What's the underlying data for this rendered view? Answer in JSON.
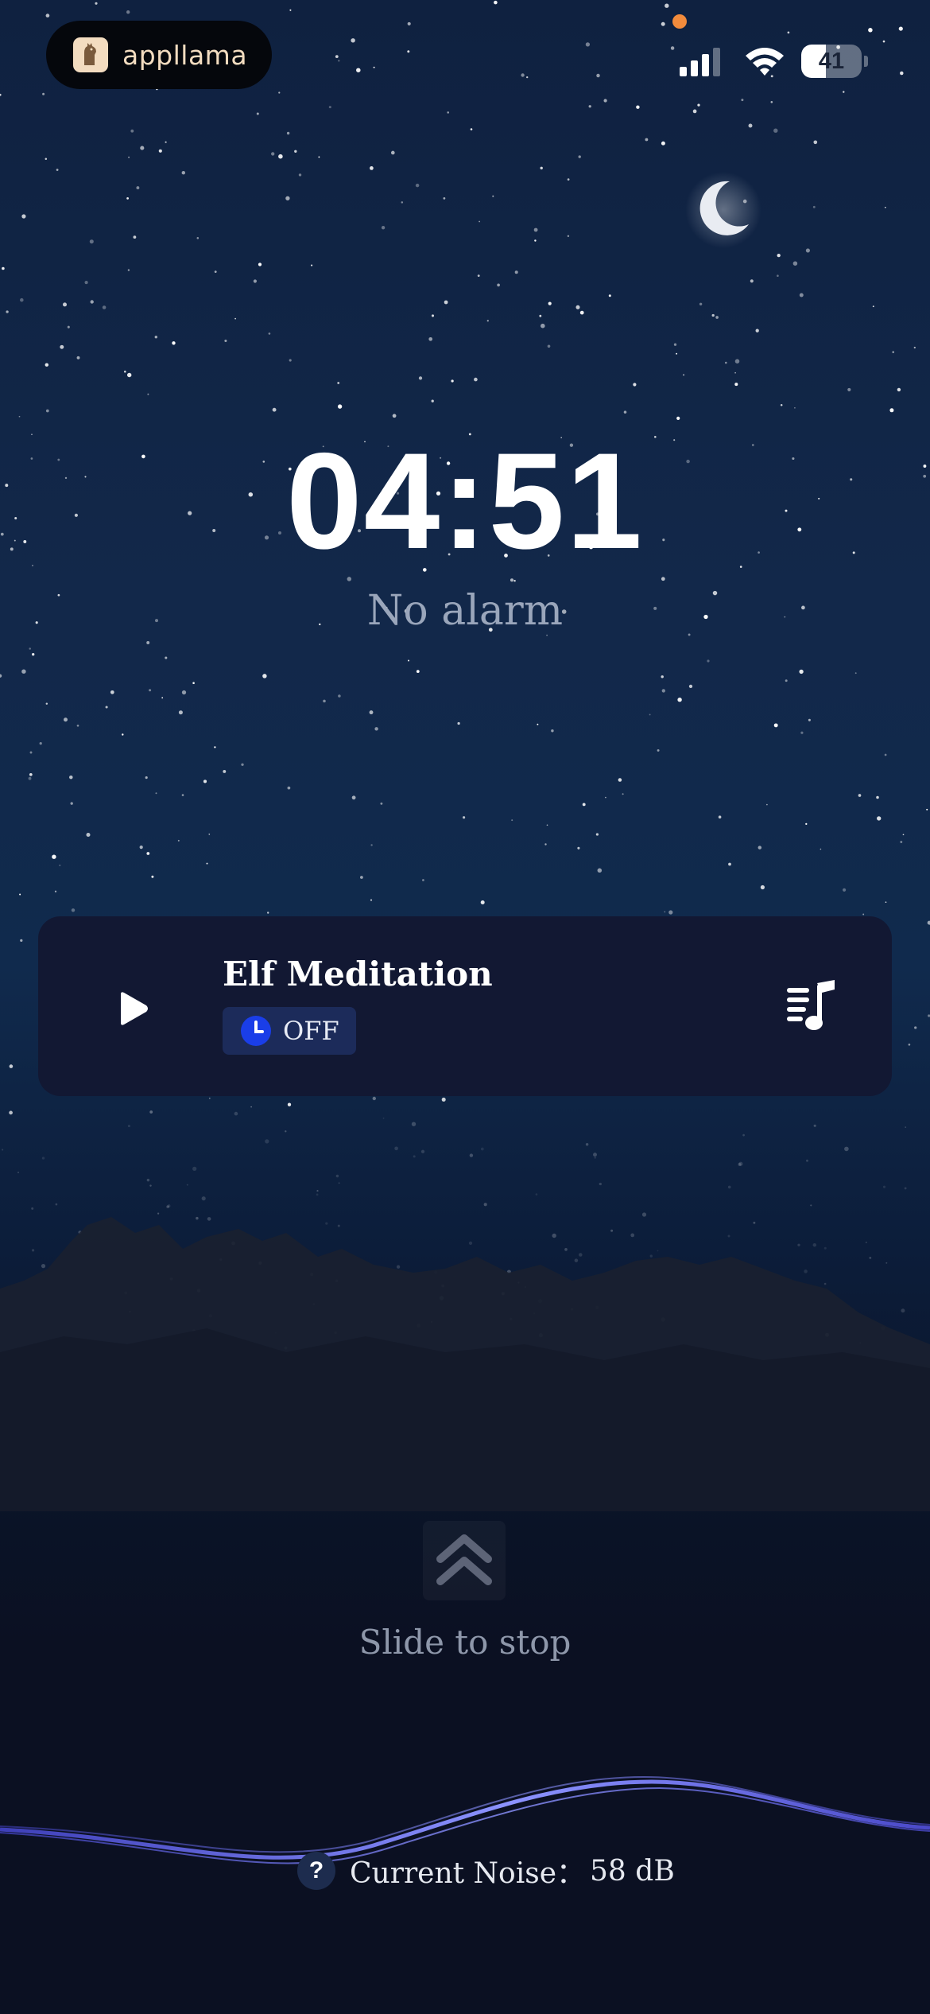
{
  "status_bar": {
    "brand": "appllama",
    "battery_level": "41",
    "battery_fraction": 0.41
  },
  "clock": {
    "time": "04:51",
    "alarm_status": "No alarm"
  },
  "player": {
    "track_title": "Elf Meditation",
    "timer_label": "OFF"
  },
  "slide": {
    "label": "Slide to stop"
  },
  "noise": {
    "label": "Current Noise：",
    "value": "58 dB",
    "help_symbol": "?"
  },
  "colors": {
    "accent_blue": "#1a3ee8",
    "card_bg": "#121833",
    "recording_dot": "#f28b3c",
    "wave": "#5b5fe0"
  }
}
